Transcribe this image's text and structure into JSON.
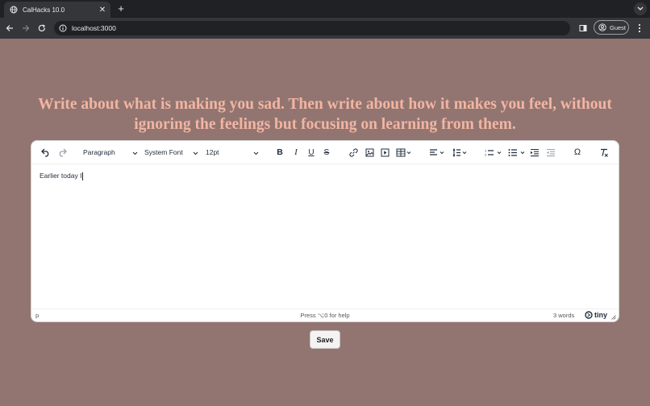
{
  "browser": {
    "tab_title": "CalHacks 10.0",
    "url": "localhost:3000",
    "profile_label": "Guest",
    "icons": [
      "globe-icon",
      "close-icon",
      "plus-icon",
      "chevron-down-icon",
      "back-icon",
      "forward-icon",
      "reload-icon",
      "info-icon",
      "side-panel-icon",
      "avatar-icon",
      "kebab-icon"
    ]
  },
  "page": {
    "prompt": "Write about what is making you sad. Then write about how it makes you feel, without ignoring the feelings but focusing on learning from them.",
    "prompt_color": "#f2b5a2",
    "background_color": "#927571",
    "save_label": "Save"
  },
  "editor": {
    "block_format": "Paragraph",
    "font_family": "System Font",
    "font_size": "12pt",
    "content": "Earlier today I",
    "status": {
      "path": "p",
      "help": "Press ⌥0 for help",
      "word_count": "3 words",
      "brand": "tiny"
    },
    "toolbar_icons": [
      "undo-icon",
      "redo-icon",
      "bold-icon",
      "italic-icon",
      "underline-icon",
      "strikethrough-icon",
      "link-icon",
      "image-icon",
      "media-icon",
      "table-icon",
      "align-icon",
      "line-height-icon",
      "numbered-list-icon",
      "bullet-list-icon",
      "indent-icon",
      "outdent-icon",
      "special-character-icon",
      "clear-formatting-icon"
    ]
  }
}
